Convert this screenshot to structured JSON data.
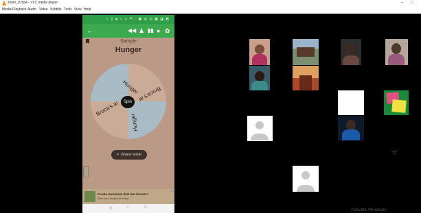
{
  "window": {
    "title": "zoom_0.mp4 - VLC media player",
    "minimize": "–",
    "maximize": "□"
  },
  "menu": [
    "Media",
    "Playback",
    "Audio",
    "Video",
    "Subtitle",
    "Tools",
    "View",
    "Help"
  ],
  "phone": {
    "status_text": "∿ ▯ ◈ ⌂ ◇ ☂ · ▣ ◎ ◎ ▩ ◪ ◩ ⊙",
    "app_title": "Sample",
    "result_title": "Hunger",
    "wheel_segments": [
      "Hunger",
      "Broca's ar",
      "Hunger",
      "Broca's ar"
    ],
    "spin_label": "Spin",
    "share_label": "Share result",
    "ad_text": "Create memories that last forever!",
    "ad_sub": "Start your family tree today",
    "ad_close": "✕",
    "nav": [
      "◁",
      "○",
      "□"
    ]
  },
  "overlay": {
    "watermark": "Activate Windows",
    "heart": "♡"
  },
  "colors": {
    "accent": "#3daa50",
    "wheel_blue": "#a9bcc6",
    "wheel_tan": "#c9ab97"
  }
}
